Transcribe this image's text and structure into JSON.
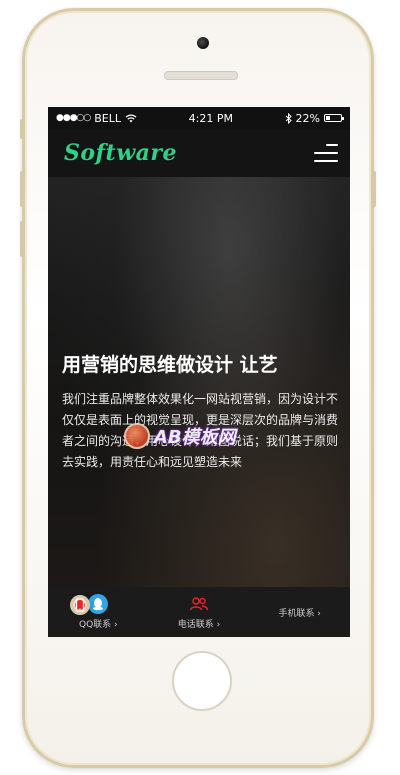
{
  "status_bar": {
    "signal": "●●●○○",
    "carrier": "BELL",
    "time": "4:21 PM",
    "battery": "22%"
  },
  "navbar": {
    "logo": "Software"
  },
  "hero": {
    "title": "用营销的思维做设计 让艺",
    "body": "我们注重品牌整体效果化一网站视营销，因为设计不仅仅是表面上的视觉呈现，更是深层次的品牌与消费者之间的沟通，用心设计，用图说话；我们基于原则去实践，用责任心和远见塑造未来"
  },
  "watermark": {
    "text": "AB模板网"
  },
  "bottom_bar": {
    "tabs": [
      {
        "icon": "qq-icon",
        "label": "QQ联系 ›"
      },
      {
        "icon": "contacts-icon",
        "label": "电话联系 ›"
      },
      {
        "icon": "mobile-phone-icon",
        "label": "手机联系 ›"
      }
    ]
  },
  "colors": {
    "logo": "#2fd08a",
    "qq_icon_bg": "#2fa6e8",
    "tel_icon": "#e8262a",
    "mobile_icon_bg": "#e8262a"
  }
}
